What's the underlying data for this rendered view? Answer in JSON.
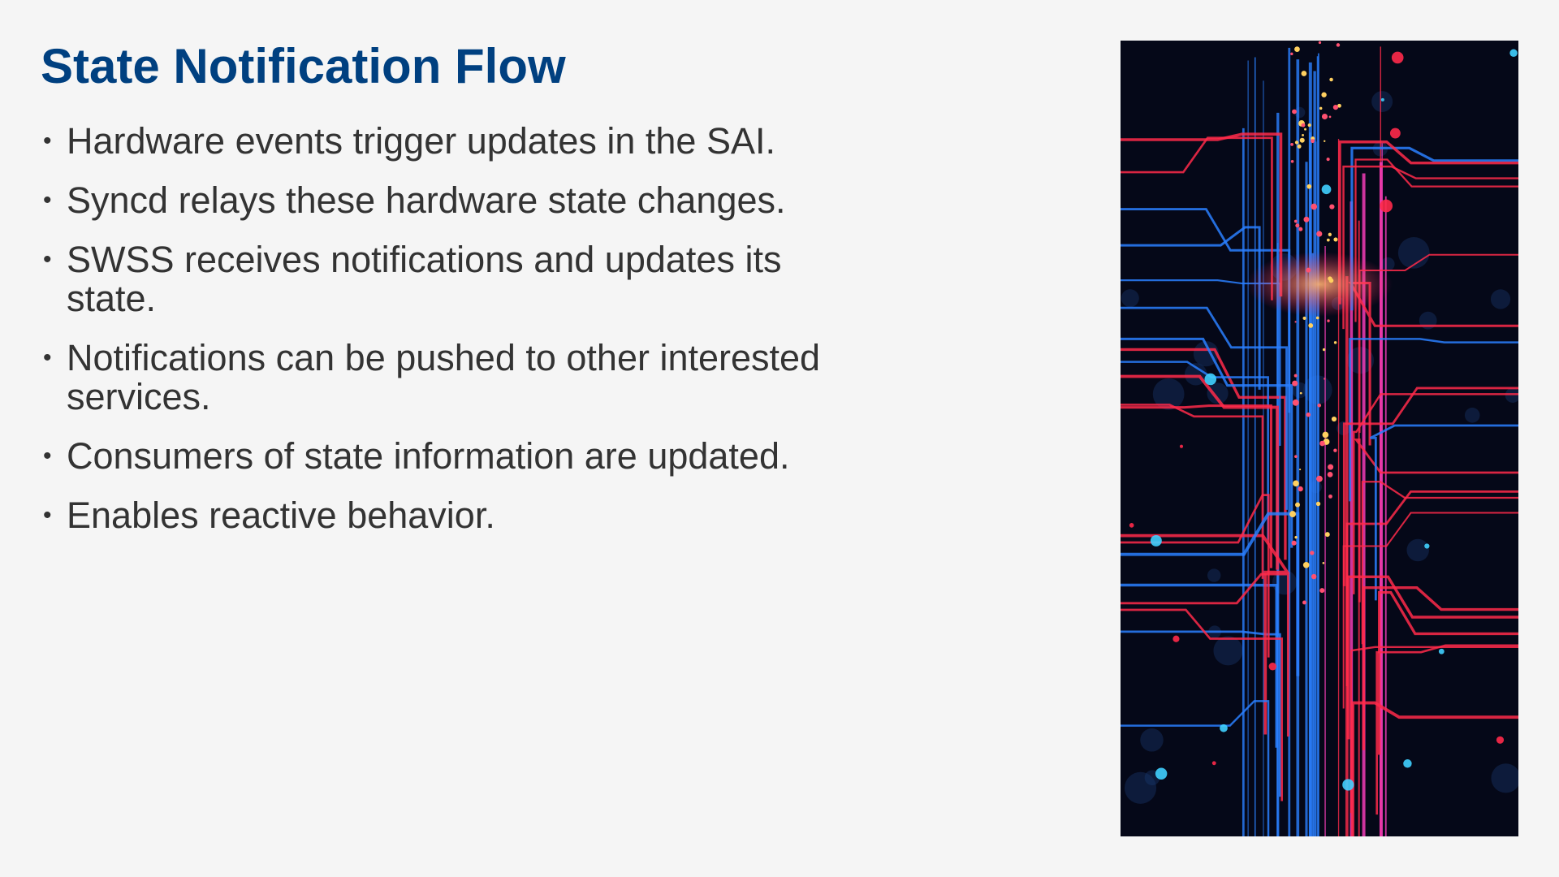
{
  "slide": {
    "title": "State Notification Flow",
    "bullets": [
      "Hardware events trigger updates in the SAI.",
      "Syncd relays these hardware state changes.",
      "SWSS receives notifications and updates its state.",
      "Notifications can be pushed to other interested services.",
      "Consumers of state information are updated.",
      "Enables reactive behavior."
    ],
    "image": {
      "icon": "circuit-board-image",
      "colors": [
        "#ff2a4a",
        "#2a7fff",
        "#ff40c0",
        "#ffd060"
      ]
    },
    "title_color": "#004080",
    "text_color": "#333333"
  }
}
